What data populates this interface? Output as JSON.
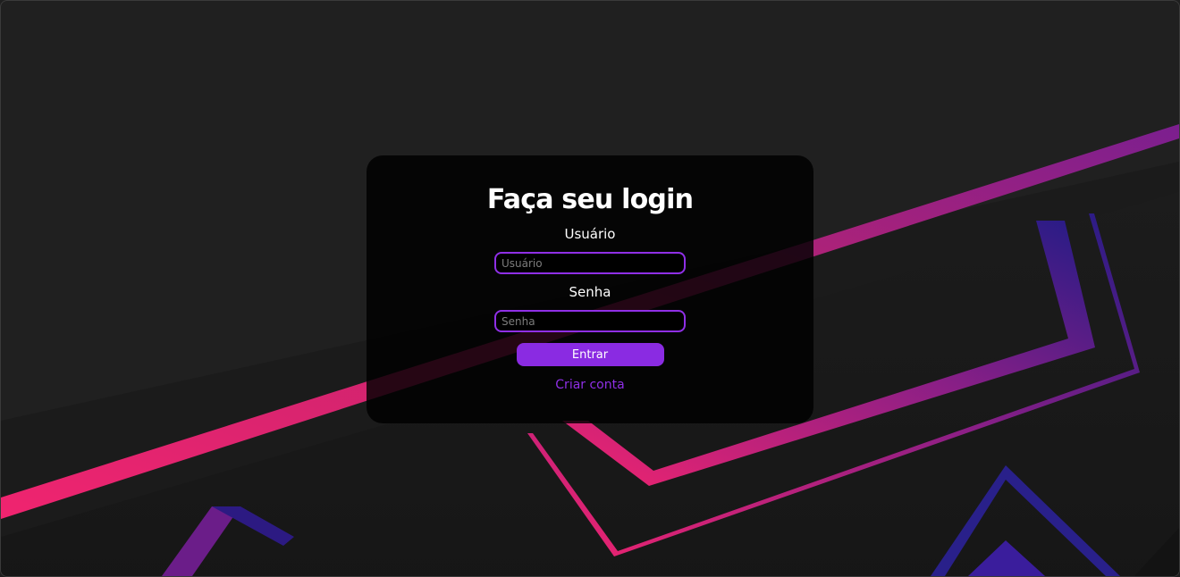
{
  "login": {
    "title": "Faça seu login",
    "username_label": "Usuário",
    "username_placeholder": "Usuário",
    "username_value": "",
    "password_label": "Senha",
    "password_placeholder": "Senha",
    "password_value": "",
    "submit_label": "Entrar",
    "create_account_label": "Criar conta"
  },
  "theme": {
    "background": "#202020",
    "card_background": "#0b0b0b",
    "accent": "#8a2be2",
    "pink": "#f0246f",
    "indigo": "#2b1877"
  }
}
